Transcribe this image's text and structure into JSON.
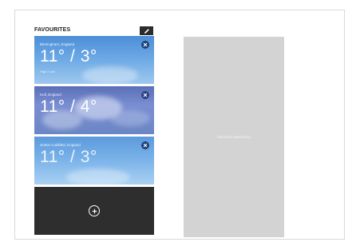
{
  "favourites": {
    "title": "FAVOURITES",
    "edit_icon": "pencil-icon"
  },
  "tiles": [
    {
      "city": "Birmingham, England",
      "temps": "11° / 3°",
      "hilo": "High / Low",
      "close_icon": "close-icon"
    },
    {
      "city": "Hull, England",
      "temps": "11° / 4°",
      "hilo": "",
      "close_icon": "close-icon"
    },
    {
      "city": "Sutton Coldfield, England",
      "temps": "11° / 3°",
      "hilo": "",
      "close_icon": "close-icon"
    }
  ],
  "add_tile": {
    "icon": "add-circle-icon"
  },
  "advertising": {
    "label": "Microsoft Advertising"
  },
  "colors": {
    "edit_button": "#2b2b2b",
    "add_tile": "#2e2e2e",
    "ad_panel": "#d3d3d3",
    "close_button": "#1d3f7a"
  }
}
